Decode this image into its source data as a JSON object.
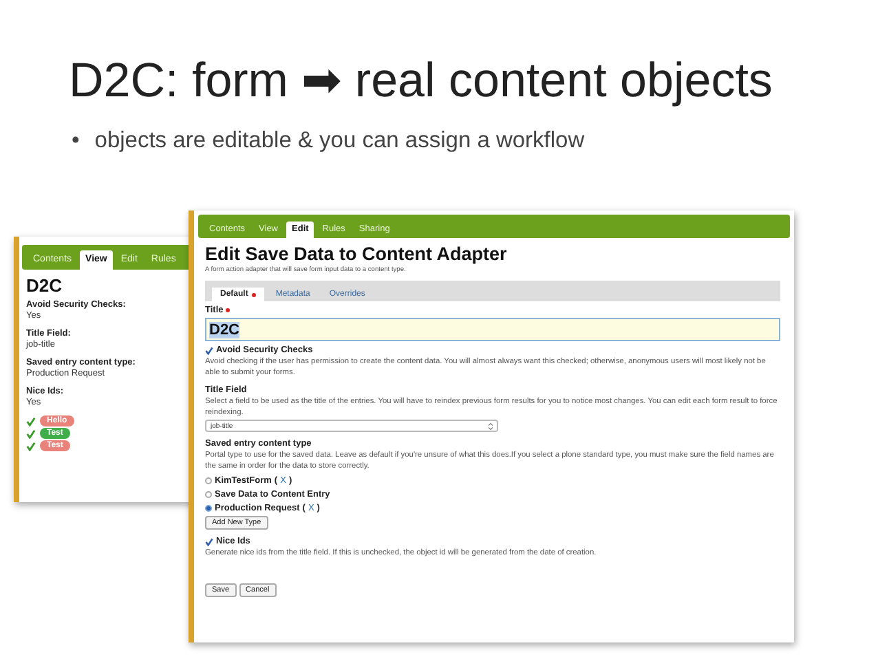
{
  "slide": {
    "title": "D2C: form ➡ real content objects",
    "bullet_mark": "•",
    "bullet": "objects are editable & you can assign a workflow"
  },
  "view_window": {
    "tabs": [
      {
        "label": "Contents",
        "selected": false
      },
      {
        "label": "View",
        "selected": true
      },
      {
        "label": "Edit",
        "selected": false
      },
      {
        "label": "Rules",
        "selected": false
      }
    ],
    "heading": "D2C",
    "fields": [
      {
        "label": "Avoid Security Checks:",
        "value": "Yes"
      },
      {
        "label": "Title Field:",
        "value": "job-title"
      },
      {
        "label": "Saved entry content type:",
        "value": "Production Request"
      },
      {
        "label": "Nice Ids:",
        "value": "Yes"
      }
    ],
    "tags": [
      {
        "label": "Hello",
        "checked": true,
        "color": "#e8827a"
      },
      {
        "label": "Test",
        "checked": true,
        "color": "#3fae4a"
      },
      {
        "label": "Test",
        "checked": true,
        "color": "#e8827a"
      }
    ]
  },
  "edit_window": {
    "tabs": [
      {
        "label": "Contents",
        "selected": false
      },
      {
        "label": "View",
        "selected": false
      },
      {
        "label": "Edit",
        "selected": true
      },
      {
        "label": "Rules",
        "selected": false
      },
      {
        "label": "Sharing",
        "selected": false
      }
    ],
    "heading": "Edit Save Data to Content Adapter",
    "description": "A form action adapter that will save form input data to a content type.",
    "form_tabs": [
      {
        "label": "Default",
        "selected": true,
        "required": true
      },
      {
        "label": "Metadata",
        "selected": false,
        "required": false
      },
      {
        "label": "Overrides",
        "selected": false,
        "required": false
      }
    ],
    "title_field": {
      "label": "Title",
      "required": true,
      "value": "D2C"
    },
    "avoid_security": {
      "label": "Avoid Security Checks",
      "checked": true,
      "help": "Avoid checking if the user has permission to create the content data. You will almost always want this checked; otherwise, anonymous users will most likely not be able to submit your forms."
    },
    "title_select": {
      "label": "Title Field",
      "help": "Select a field to be used as the title of the entries. You will have to reindex previous form results for you to notice most changes. You can edit each form result to force reindexing.",
      "value": "job-title"
    },
    "content_type": {
      "label": "Saved entry content type",
      "help": "Portal type to use for the saved data. Leave as default if you're unsure of what this does.If you select a plone standard type, you must make sure the field names are the same in order for the data to store correctly.",
      "options": [
        {
          "label": "KimTestForm",
          "selected": false,
          "open": "(",
          "link": "X",
          "close": ")"
        },
        {
          "label": "Save Data to Content Entry",
          "selected": false
        },
        {
          "label": "Production Request",
          "selected": true,
          "open": "(",
          "link": "X",
          "close": ")"
        }
      ],
      "add_button": "Add New Type"
    },
    "nice_ids": {
      "label": "Nice Ids",
      "checked": true,
      "help": "Generate nice ids from the title field. If this is unchecked, the object id will be generated from the date of creation."
    },
    "buttons": [
      "Save",
      "Cancel"
    ]
  }
}
